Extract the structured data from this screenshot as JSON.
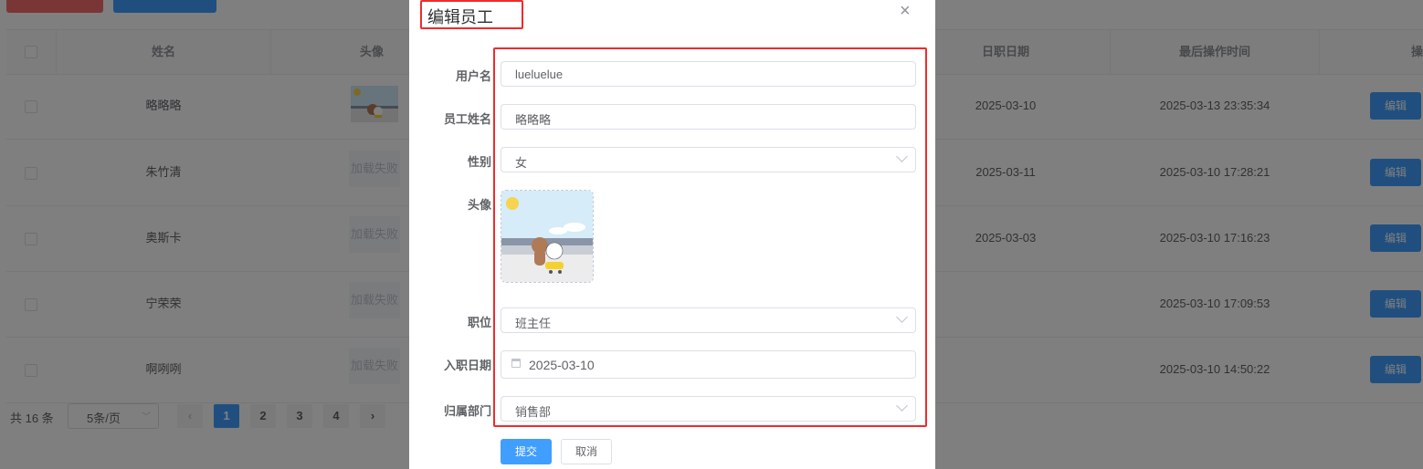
{
  "table": {
    "headers": [
      "姓名",
      "头像",
      "日职日期",
      "最后操作时间",
      "操"
    ],
    "rows": [
      {
        "name": "略略略",
        "avatar_fail": "",
        "entry_date": "2025-03-10",
        "last_op": "2025-03-13 23:35:34",
        "action": "编辑"
      },
      {
        "name": "朱竹清",
        "avatar_fail": "加载失败",
        "entry_date": "2025-03-11",
        "last_op": "2025-03-10 17:28:21",
        "action": "编辑"
      },
      {
        "name": "奥斯卡",
        "avatar_fail": "加载失败",
        "entry_date": "2025-03-03",
        "last_op": "2025-03-10 17:16:23",
        "action": "编辑"
      },
      {
        "name": "宁荣荣",
        "avatar_fail": "加载失败",
        "entry_date": "",
        "last_op": "2025-03-10 17:09:53",
        "action": "编辑"
      },
      {
        "name": "啊咧咧",
        "avatar_fail": "加载失败",
        "entry_date": "",
        "last_op": "2025-03-10 14:50:22",
        "action": "编辑"
      }
    ]
  },
  "pagination": {
    "total": "共 16 条",
    "page_size": "5条/页",
    "prev": "‹",
    "next": "›",
    "pages": [
      "1",
      "2",
      "3",
      "4"
    ],
    "current": "1"
  },
  "dialog": {
    "title": "编辑员工",
    "close": "×",
    "fields": {
      "username": {
        "label": "用户名",
        "value": "lueluelue"
      },
      "name": {
        "label": "员工姓名",
        "value": "略略略"
      },
      "gender": {
        "label": "性别",
        "value": "女"
      },
      "avatar": {
        "label": "头像"
      },
      "job": {
        "label": "职位",
        "value": "班主任"
      },
      "entry_date": {
        "label": "入职日期",
        "value": "2025-03-10"
      },
      "dept": {
        "label": "归属部门",
        "value": "销售部"
      }
    },
    "submit": "提交",
    "cancel": "取消"
  },
  "colors": {
    "primary": "#409eff",
    "danger": "#f56c6c",
    "highlight": "#f02b2b",
    "overlay": "rgba(0,0,0,0.5)"
  }
}
